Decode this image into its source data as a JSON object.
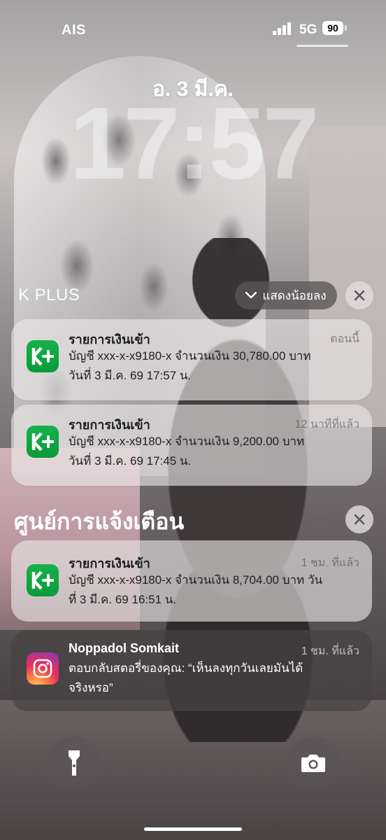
{
  "status_bar": {
    "carrier": "AIS",
    "network": "5G",
    "battery": "90"
  },
  "lock": {
    "date": "อ. 3 มี.ค.",
    "time": "17:57"
  },
  "kplus_group": {
    "app_name": "K PLUS",
    "show_less_label": "แสดงน้อยลง",
    "notifications": [
      {
        "title": "รายการเงินเข้า",
        "time": "ตอนนี้",
        "line1": "บัญชี xxx-x-x9180-x  จำนวนเงิน 30,780.00 บาท",
        "line2": "วันที่ 3 มี.ค. 69  17:57 น."
      },
      {
        "title": "รายการเงินเข้า",
        "time": "12 นาทีที่แล้ว",
        "line1": "บัญชี xxx-x-x9180-x  จำนวนเงิน 9,200.00 บาท",
        "line2": "วันที่ 3 มี.ค. 69  17:45 น."
      }
    ]
  },
  "notification_center": {
    "title": "ศูนย์การแจ้งเตือน",
    "notifications": [
      {
        "title": "รายการเงินเข้า",
        "time": "1 ชม. ที่แล้ว",
        "line1": "บัญชี xxx-x-x9180-x  จำนวนเงิน 8,704.00 บาท  วัน",
        "line2": "ที่ 3 มี.ค. 69  16:51 น."
      },
      {
        "title": "Noppadol Somkait",
        "time": "1 ชม. ที่แล้ว",
        "line1": "ตอบกลับสตอรี่ของคุณ: “เห็นลงทุกวันเลยมันได้",
        "line2": "จริงหรอ”"
      }
    ]
  },
  "bottom": {
    "left": "flashlight-icon",
    "right": "camera-icon"
  }
}
